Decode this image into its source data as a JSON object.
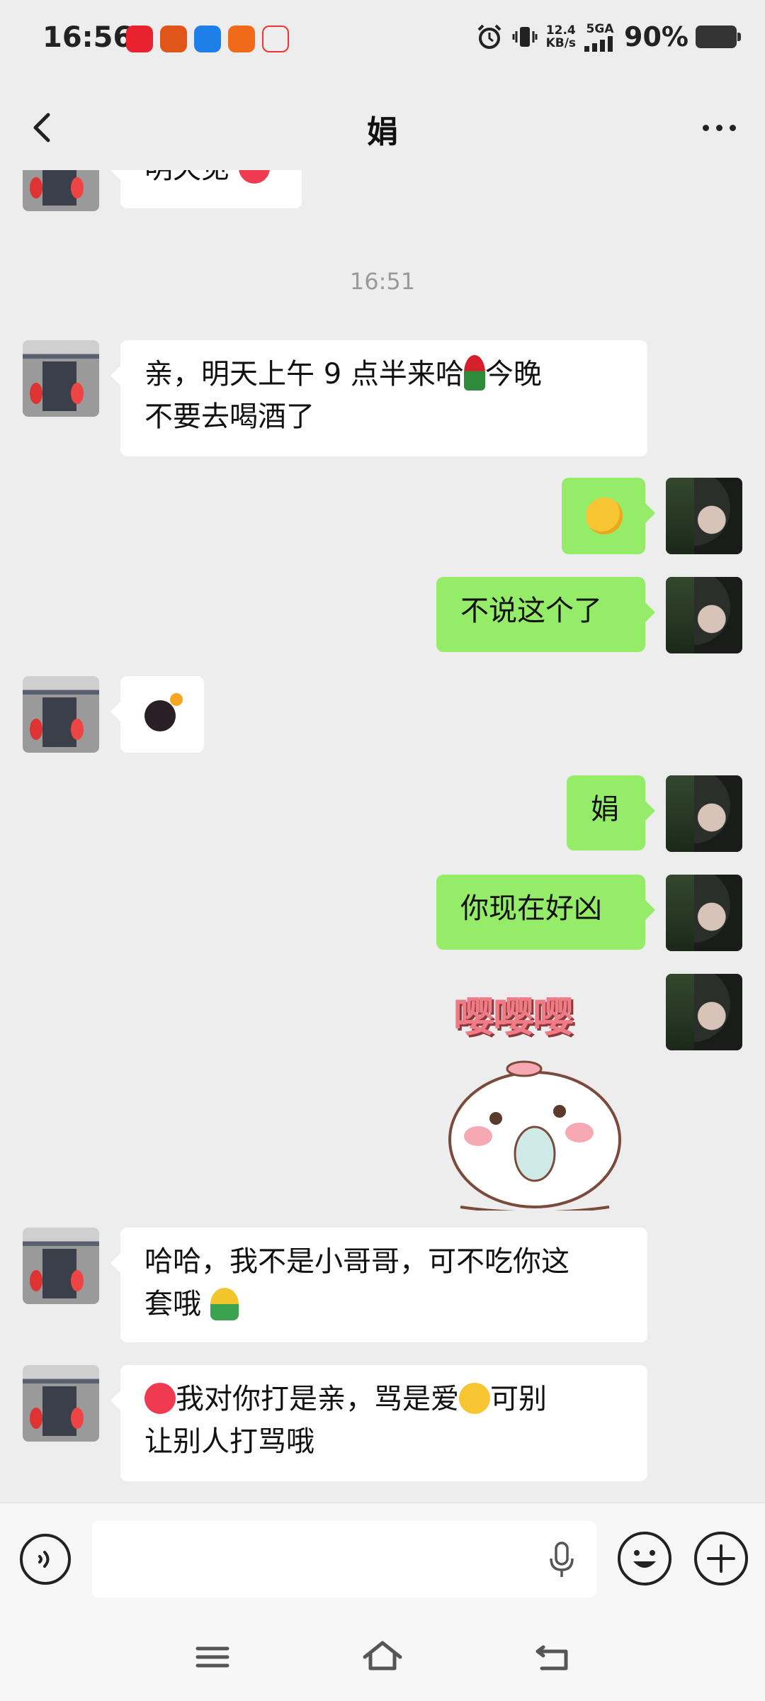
{
  "status_bar": {
    "time": "16:56",
    "net_speed_value": "12.4",
    "net_speed_unit": "KB/s",
    "network": "5GA",
    "battery": "90%"
  },
  "header": {
    "title": "娟"
  },
  "messages": [
    {
      "side": "left",
      "text": "明天见"
    },
    {
      "type": "timestamp",
      "text": "16:51"
    },
    {
      "side": "left",
      "text_a": "亲，明天上午 9 点半来哈",
      "text_b": "今晚",
      "text_c": "不要去喝酒了"
    },
    {
      "side": "right",
      "emoji": "slightly-smiling-face"
    },
    {
      "side": "right",
      "text": "不说这个了"
    },
    {
      "side": "left",
      "emoji": "bomb"
    },
    {
      "side": "right",
      "text": "娟"
    },
    {
      "side": "right",
      "text": "你现在好凶"
    },
    {
      "side": "right",
      "sticker_text": "嘤嘤嘤"
    },
    {
      "side": "left",
      "text_a": "哈哈，我不是小哥哥，可不吃你这",
      "text_b": "套哦"
    },
    {
      "side": "left",
      "text_a": "我对你打是亲，骂是爱",
      "text_b": "可别",
      "text_c": "让别人打骂哦"
    }
  ],
  "input": {
    "placeholder": ""
  },
  "colors": {
    "background": "#ededed",
    "bubble_right": "#95ec69",
    "bubble_left": "#ffffff"
  }
}
